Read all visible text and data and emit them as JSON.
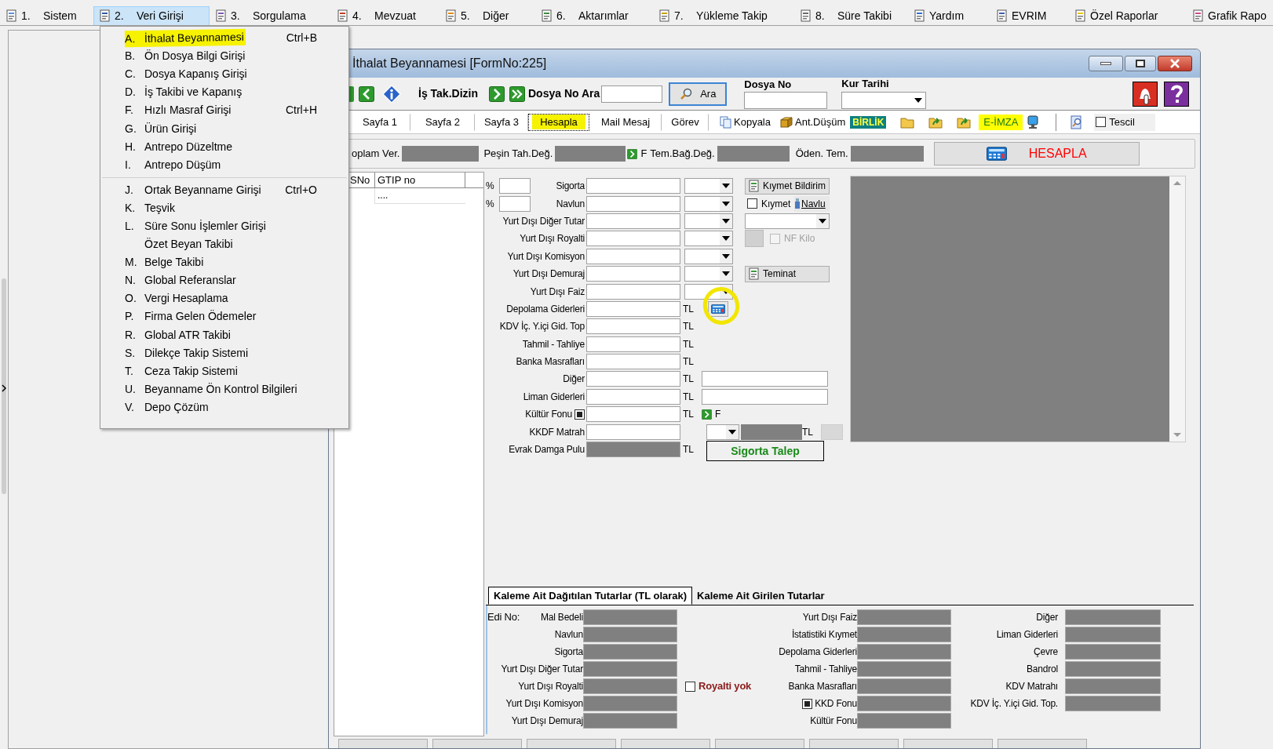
{
  "menu_bar": {
    "items": [
      {
        "num": "1.",
        "label": "Sistem",
        "selected": false
      },
      {
        "num": "2.",
        "label": "Veri Girişi",
        "selected": true
      },
      {
        "num": "3.",
        "label": "Sorgulama",
        "selected": false
      },
      {
        "num": "4.",
        "label": "Mevzuat",
        "selected": false
      },
      {
        "num": "5.",
        "label": "Diğer",
        "selected": false
      },
      {
        "num": "6.",
        "label": "Aktarımlar",
        "selected": false
      },
      {
        "num": "7.",
        "label": "Yükleme Takip",
        "selected": false
      },
      {
        "num": "8.",
        "label": "Süre Takibi",
        "selected": false
      },
      {
        "label": "Yardım",
        "selected": false
      },
      {
        "label": "EVRIM",
        "selected": false
      },
      {
        "label": "Özel Raporlar",
        "selected": false
      },
      {
        "label": "Grafik Rapo",
        "selected": false
      }
    ]
  },
  "dropdown": {
    "groups": [
      [
        {
          "key": "A.",
          "label": "İthalat Beyannamesi",
          "shortcut": "Ctrl+B",
          "highlighted": true
        },
        {
          "key": "B.",
          "label": "Ön Dosya Bilgi Girişi",
          "highlighted": false
        },
        {
          "key": "C.",
          "label": "Dosya Kapanış Girişi",
          "highlighted": false
        },
        {
          "key": "D.",
          "label": "İş Takibi ve Kapanış",
          "highlighted": false
        },
        {
          "key": "F.",
          "label": "Hızlı Masraf Girişi",
          "shortcut": "Ctrl+H",
          "highlighted": false
        },
        {
          "key": "G.",
          "label": "Ürün Girişi",
          "highlighted": false
        },
        {
          "key": "H.",
          "label": "Antrepo Düzeltme",
          "highlighted": false
        },
        {
          "key": "I.",
          "label": "Antrepo Düşüm",
          "highlighted": false
        }
      ],
      [
        {
          "key": "J.",
          "label": "Ortak Beyanname Girişi",
          "shortcut": "Ctrl+O",
          "highlighted": false
        },
        {
          "key": "K.",
          "label": "Teşvik",
          "highlighted": false
        },
        {
          "key": "L.",
          "label": "Süre Sonu İşlemler Girişi",
          "highlighted": false
        },
        {
          "label": "Özet Beyan Takibi",
          "highlighted": false
        },
        {
          "key": "M.",
          "label": "Belge Takibi",
          "highlighted": false
        },
        {
          "key": "N.",
          "label": "Global Referanslar",
          "highlighted": false
        },
        {
          "key": "O.",
          "label": "Vergi Hesaplama",
          "highlighted": false
        },
        {
          "key": "P.",
          "label": "Firma Gelen Ödemeler",
          "highlighted": false
        },
        {
          "key": "R.",
          "label": "Global ATR Takibi",
          "highlighted": false
        },
        {
          "key": "S.",
          "label": "Dilekçe Takip Sistemi",
          "highlighted": false
        },
        {
          "key": "T.",
          "label": "Ceza Takip Sistemi",
          "highlighted": false
        },
        {
          "key": "U.",
          "label": "Beyanname Ön Kontrol Bilgileri",
          "highlighted": false
        },
        {
          "key": "V.",
          "label": "Depo Çözüm",
          "highlighted": false
        }
      ]
    ]
  },
  "window": {
    "title": "İthalat Beyannamesi [FormNo:225]",
    "toolbar": {
      "dir_label": "İş Tak.Dizin",
      "search_label": "Dosya No Ara",
      "search_button": "Ara",
      "dosya_no_label": "Dosya No",
      "kur_tarihi_label": "Kur Tarihi"
    },
    "tabs": [
      {
        "label": "Sayfa 1",
        "selected": false,
        "highlighted": false
      },
      {
        "label": "Sayfa 2",
        "selected": false,
        "highlighted": false
      },
      {
        "label": "Sayfa 3",
        "selected": false,
        "highlighted": false
      },
      {
        "label": "Hesapla",
        "selected": true,
        "highlighted": true
      },
      {
        "label": "Mail Mesaj",
        "selected": false,
        "highlighted": false
      },
      {
        "label": "Görev",
        "selected": false,
        "highlighted": false
      }
    ],
    "tools": {
      "kopyala": "Kopyala",
      "ant_dusum": "Ant.Düşüm",
      "birlik": "BİRLİK",
      "e_imza": "E-İMZA",
      "tescil": {
        "label": "Tescil",
        "checked": false
      }
    },
    "totals": {
      "items": [
        {
          "label": "oplam Ver."
        },
        {
          "label": "Peşin Tah.Değ."
        },
        {
          "label": "Tem.Bağ.Değ.",
          "marker": "F"
        },
        {
          "label": "Öden. Tem."
        }
      ],
      "calc_button": "HESAPLA"
    },
    "list": {
      "columns": [
        "SNo",
        "GTIP no"
      ],
      "rows": [
        {
          "gtip": "...."
        }
      ]
    },
    "form": {
      "rows": [
        {
          "percent": "%",
          "label": "Sigorta",
          "readonly": false,
          "kind": "combo",
          "side": {
            "kind": "button",
            "label": "Kıymet Bildirim"
          }
        },
        {
          "percent": "%",
          "label": "Navlun",
          "readonly": false,
          "kind": "combo",
          "side": {
            "kind": "check_link",
            "label": "Kıymet",
            "checked": false,
            "link": "Navlu"
          }
        },
        {
          "label": "Yurt Dışı Diğer Tutar",
          "readonly": false,
          "kind": "combo",
          "side": {
            "kind": "combo"
          }
        },
        {
          "label": "Yurt Dışı Royalti",
          "readonly": false,
          "kind": "combo",
          "side": {
            "kind": "nf",
            "label": "NF Kilo",
            "checked": false,
            "disabled": true
          }
        },
        {
          "label": "Yurt Dışı Komisyon",
          "readonly": false,
          "kind": "combo"
        },
        {
          "label": "Yurt Dışı Demuraj",
          "readonly": false,
          "kind": "combo",
          "side": {
            "kind": "button",
            "label": "Teminat"
          }
        },
        {
          "label": "Yurt Dışı Faiz",
          "readonly": false,
          "kind": "combo"
        },
        {
          "label": "Depolama Giderleri",
          "readonly": false,
          "kind": "unit",
          "unit": "TL",
          "side": {
            "kind": "calc",
            "circled": true
          }
        },
        {
          "label": "KDV İç. Y.içi Gid. Top",
          "readonly": false,
          "kind": "unit",
          "unit": "TL"
        },
        {
          "label": "Tahmil - Tahliye",
          "readonly": false,
          "kind": "unit",
          "unit": "TL"
        },
        {
          "label": "Banka Masrafları",
          "readonly": false,
          "kind": "unit",
          "unit": "TL"
        },
        {
          "label": "Diğer",
          "readonly": false,
          "kind": "unit",
          "unit": "TL",
          "side": {
            "kind": "wide_field"
          }
        },
        {
          "label": "Liman Giderleri",
          "readonly": false,
          "kind": "unit",
          "unit": "TL",
          "side": {
            "kind": "wide_field"
          }
        },
        {
          "label": "Kültür Fonu",
          "flag": {
            "checked": true
          },
          "readonly": false,
          "kind": "unit",
          "unit": "TL",
          "side": {
            "kind": "arrow_f",
            "label": "F"
          }
        },
        {
          "label": "KKDF Matrah",
          "readonly": false,
          "kind": "plain",
          "side": {
            "kind": "kkdf",
            "unit": "TL"
          }
        },
        {
          "label": "Evrak Damga Pulu",
          "readonly": true,
          "kind": "unit",
          "unit": "TL",
          "side": {
            "kind": "talep",
            "label": "Sigorta Talep"
          }
        }
      ]
    },
    "bottom": {
      "tabs": [
        {
          "label": "Kaleme Ait Dağıtılan Tutarlar (TL olarak)",
          "selected": true
        },
        {
          "label": "Kaleme Ait Girilen Tutarlar",
          "selected": false
        }
      ],
      "edi_label": "Edi No:",
      "column_1": [
        "Mal Bedeli",
        "Navlun",
        "Sigorta",
        "Yurt Dışı Diğer Tutar",
        "Yurt Dışı Royalti",
        "Yurt Dışı Komisyon",
        "Yurt Dışı Demuraj"
      ],
      "royalti": {
        "label": "Royalti yok",
        "checked": false
      },
      "column_2": [
        {
          "label": "Yurt Dışı Faiz",
          "kind": "plain"
        },
        {
          "label": "İstatistiki Kıymet",
          "kind": "plain"
        },
        {
          "label": "Depolama Giderleri",
          "kind": "plain"
        },
        {
          "label": "Tahmil - Tahliye",
          "kind": "plain"
        },
        {
          "label": "Banka Masrafları",
          "kind": "plain"
        },
        {
          "label": "KKD Fonu",
          "kind": "flag",
          "checked": true
        },
        {
          "label": "Kültür Fonu",
          "kind": "plain"
        }
      ],
      "column_3": [
        "Diğer",
        "Liman Giderleri",
        "Çevre",
        "Bandrol",
        "KDV Matrahı",
        "KDV İç. Y.içi Gid. Top."
      ]
    }
  }
}
